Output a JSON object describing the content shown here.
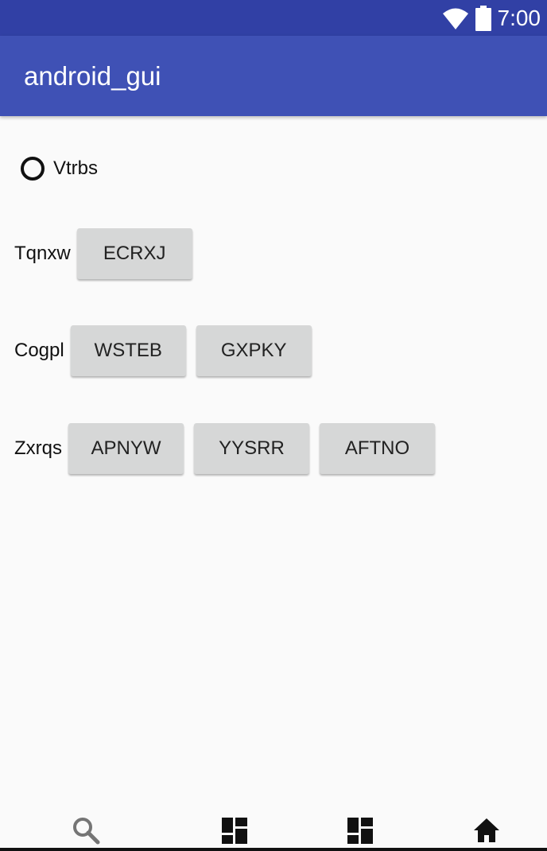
{
  "status_bar": {
    "time": "7:00",
    "icons": [
      "wifi-icon",
      "battery-icon"
    ]
  },
  "app_bar": {
    "title": "android_gui"
  },
  "radio": {
    "label": "Vtrbs",
    "checked": false
  },
  "rows": [
    {
      "label": "Tqnxw",
      "buttons": [
        "ECRXJ"
      ]
    },
    {
      "label": "Cogpl",
      "buttons": [
        "WSTEB",
        "GXPKY"
      ]
    },
    {
      "label": "Zxrqs",
      "buttons": [
        "APNYW",
        "YYSRR",
        "AFTNO"
      ]
    }
  ],
  "bottom_nav": {
    "icons": [
      "search-icon",
      "dashboard-icon",
      "dashboard-icon",
      "home-icon"
    ]
  },
  "colors": {
    "status_bar": "#3140a5",
    "app_bar": "#3f51b5",
    "background": "#fafafa",
    "button": "#d6d7d7"
  }
}
